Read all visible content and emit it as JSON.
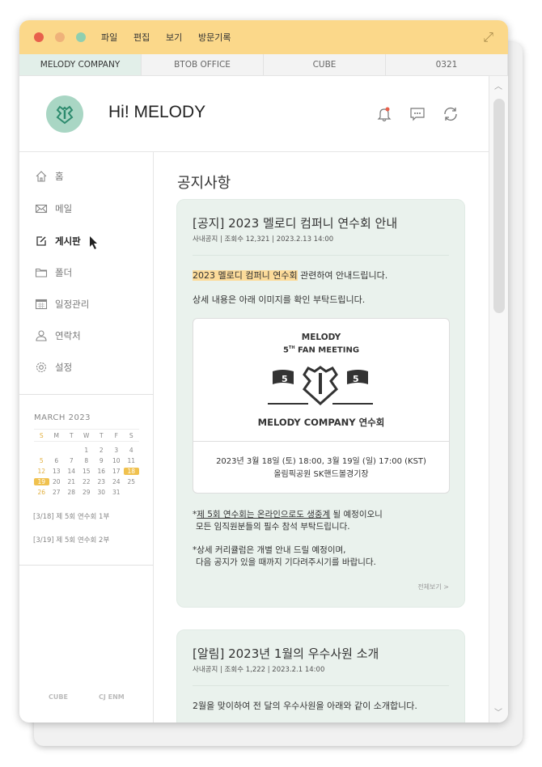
{
  "window": {
    "menu": [
      "파일",
      "편집",
      "보기",
      "방문기록"
    ],
    "dots": [
      "#e8604c",
      "#efb27a",
      "#8fcfb0"
    ],
    "accent": "#fbd88a"
  },
  "tabs": [
    {
      "label": "MELODY COMPANY",
      "active": true
    },
    {
      "label": "BTOB OFFICE"
    },
    {
      "label": "CUBE"
    },
    {
      "label": "0321"
    }
  ],
  "header": {
    "greeting": "Hi! MELODY",
    "icons": [
      "bell-icon",
      "chat-icon",
      "refresh-icon"
    ]
  },
  "sidebar": {
    "items": [
      {
        "label": "홈",
        "icon": "home-icon"
      },
      {
        "label": "메일",
        "icon": "mail-icon"
      },
      {
        "label": "게시판",
        "icon": "edit-icon",
        "active": true
      },
      {
        "label": "폴더",
        "icon": "folder-icon"
      },
      {
        "label": "일정관리",
        "icon": "calendar-icon"
      },
      {
        "label": "연락처",
        "icon": "person-icon"
      },
      {
        "label": "설정",
        "icon": "gear-icon"
      }
    ],
    "calendar": {
      "title": "MARCH 2023",
      "weekdays": [
        "S",
        "M",
        "T",
        "W",
        "T",
        "F",
        "S"
      ],
      "weeks": [
        [
          "",
          "",
          "",
          "1",
          "2",
          "3",
          "4"
        ],
        [
          "5",
          "6",
          "7",
          "8",
          "9",
          "10",
          "11"
        ],
        [
          "12",
          "13",
          "14",
          "15",
          "16",
          "17",
          "18"
        ],
        [
          "19",
          "20",
          "21",
          "22",
          "23",
          "24",
          "25"
        ],
        [
          "26",
          "27",
          "28",
          "29",
          "30",
          "31",
          ""
        ]
      ],
      "highlighted": [
        "18",
        "19"
      ]
    },
    "events": [
      "[3/18] 제 5회 연수회 1부",
      "[3/19] 제 5회 연수회 2부"
    ],
    "footer_logos": [
      "CUBE",
      "CJ ENM"
    ]
  },
  "main": {
    "title": "공지사항",
    "posts": [
      {
        "title": "[공지] 2023 멜로디 컴퍼니 연수회 안내",
        "meta": "사내공지 | 조회수 12,321 | 2023.2.13 14:00",
        "highlight": "2023 멜로디 컴퍼니 연수회",
        "line1_rest": " 관련하여 안내드립니다.",
        "line2": "상세 내용은 아래 이미지를 확인 부탁드립니다.",
        "poster": {
          "line1": "MELODY",
          "line2_sup": "TH",
          "line2_num": "5",
          "line2": "FAN MEETING",
          "flag": "5",
          "name": "MELODY COMPANY 연수회",
          "date": "2023년 3월 18일 (토) 18:00, 3월 19일 (일) 17:00 (KST)",
          "venue": "올림픽공원 SK핸드볼경기장"
        },
        "note1_u": "제 5회 연수회는 온라인으로도 생중계",
        "note1_rest": " 될 예정이오니",
        "note1_b": "모든 임직원분들의 필수 참석 부탁드립니다.",
        "note2_a": "*상세 커리큘럼은 개별 안내 드릴 예정이며,",
        "note2_b": "다음 공지가 있을 때까지 기다려주시기를 바랍니다.",
        "more": "전체보기 >"
      },
      {
        "title": "[알림] 2023년 1월의 우수사원 소개",
        "meta": "사내공지 | 조회수 1,222 | 2023.2.1 14:00",
        "line1": "2월을 맞이하여 전 달의 우수사원을 아래와 같이 소개합니다."
      }
    ]
  }
}
